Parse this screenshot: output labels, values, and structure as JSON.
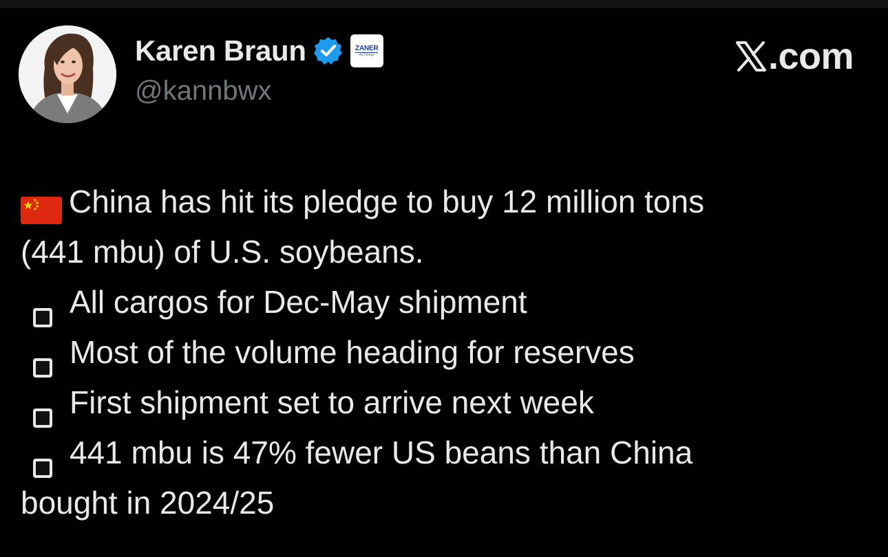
{
  "author": {
    "display_name": "Karen Braun",
    "handle": "@kannbwx",
    "verified": true,
    "affiliate": {
      "name": "ZANER",
      "subtitle": "Ag Hedge"
    }
  },
  "site": {
    "label": ".com"
  },
  "tweet": {
    "flag_emoji": "china-flag",
    "line_1": "China has hit its pledge to buy 12 million tons",
    "line_2": "(441 mbu) of U.S. soybeans.",
    "bullets": [
      "All cargos for Dec-May shipment",
      "Most of the volume heading for reserves",
      "First shipment set to arrive next week",
      "441 mbu is 47% fewer US beans than China"
    ],
    "line_last": "bought in 2024/25"
  },
  "colors": {
    "background": "#000000",
    "text": "#e7e9ea",
    "handle": "#71767b",
    "verified_blue": "#1d9bf0",
    "flag_red": "#de2910",
    "flag_star": "#ffde00"
  }
}
